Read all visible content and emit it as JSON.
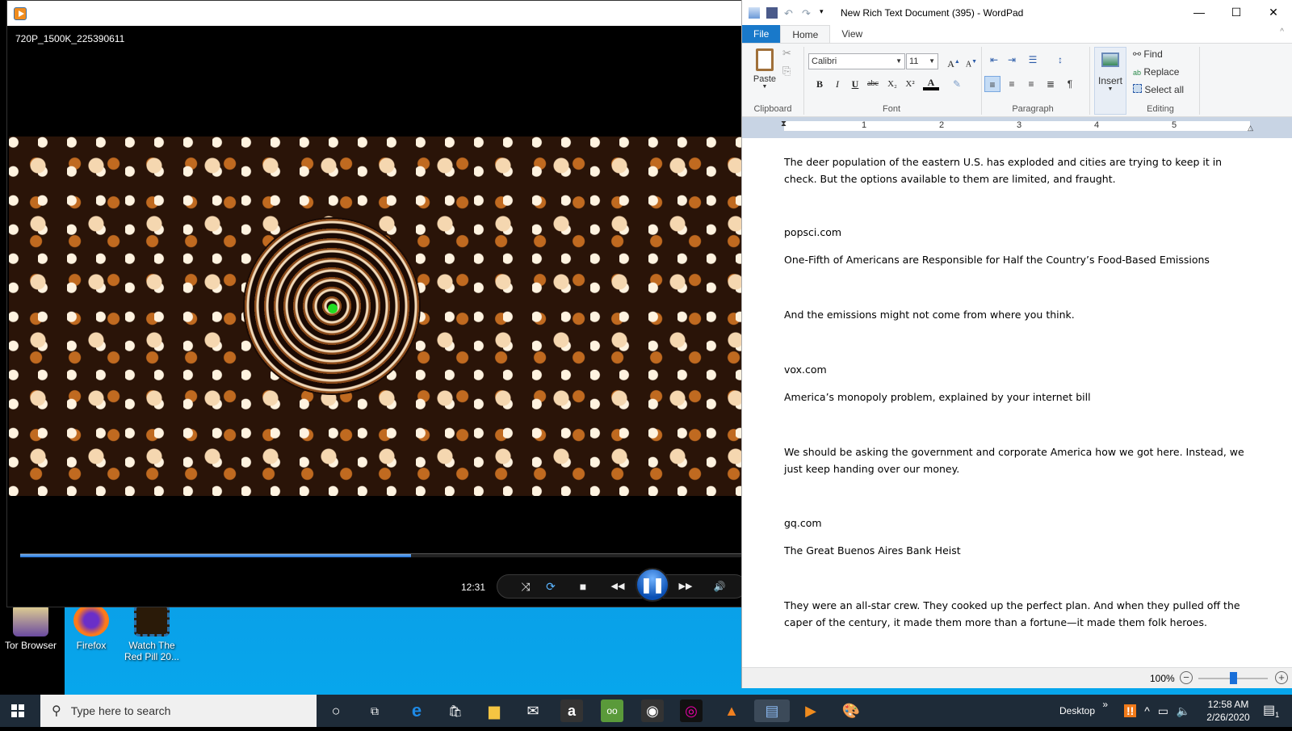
{
  "desktop": {
    "icons": [
      {
        "label": "Tor Browser",
        "icon": "tor-browser-icon"
      },
      {
        "label": "Firefox",
        "icon": "firefox-icon"
      },
      {
        "label": "Watch The Red Pill 20...",
        "icon": "video-file-icon"
      }
    ]
  },
  "player": {
    "video_name": "720P_1500K_225390611",
    "elapsed": "12:31",
    "progress_fraction": 0.54,
    "controls": {
      "shuffle": "⤨",
      "repeat": "⟳",
      "stop": "■",
      "previous": "◀◀",
      "pause": "❚❚",
      "next": "▶▶",
      "volume": "🔊"
    }
  },
  "wordpad": {
    "title": "New Rich Text Document (395) - WordPad",
    "window_buttons": {
      "minimize": "—",
      "maximize": "☐",
      "close": "✕"
    },
    "tabs": [
      "File",
      "Home",
      "View"
    ],
    "ribbon": {
      "clipboard": {
        "paste": "Paste",
        "label": "Clipboard"
      },
      "font": {
        "family": "Calibri",
        "size": "11",
        "label": "Font",
        "buttons": [
          "B",
          "I",
          "U",
          "abc",
          "X₂",
          "X²"
        ]
      },
      "paragraph": {
        "label": "Paragraph"
      },
      "insert": {
        "label": "Insert"
      },
      "editing": {
        "find": "Find",
        "replace": "Replace",
        "select_all": "Select all",
        "label": "Editing"
      }
    },
    "ruler": [
      "1",
      "2",
      "3",
      "4",
      "5"
    ],
    "document": [
      "The deer population of the eastern U.S. has exploded and cities are trying to keep it in check. But the options available to them are limited, and fraught.",
      "popsci.com",
      "One-Fifth of Americans are Responsible for Half the Country’s Food-Based Emissions",
      "And the emissions might not come from where you think.",
      "vox.com",
      "America’s monopoly problem, explained by your internet bill",
      "We should be asking the government and corporate America how we got here. Instead, we just keep handing over our money.",
      "gq.com",
      "The Great Buenos Aires Bank Heist",
      "They were an all-star crew. They cooked up the perfect plan. And when they pulled off the caper of the century, it made them more than a fortune—it made them folk heroes."
    ],
    "status": {
      "zoom": "100%",
      "zoom_out": "−",
      "zoom_in": "+"
    }
  },
  "taskbar": {
    "search_placeholder": "Type here to search",
    "apps": [
      "cortana",
      "task-view",
      "edge",
      "store",
      "file-explorer",
      "mail",
      "amazon",
      "tripadvisor",
      "camera",
      "photo-app",
      "vlc",
      "wordpad",
      "media-player",
      "paint"
    ],
    "desktop_label": "Desktop",
    "time": "12:58 AM",
    "date": "2/26/2020",
    "notification_count": "1"
  }
}
